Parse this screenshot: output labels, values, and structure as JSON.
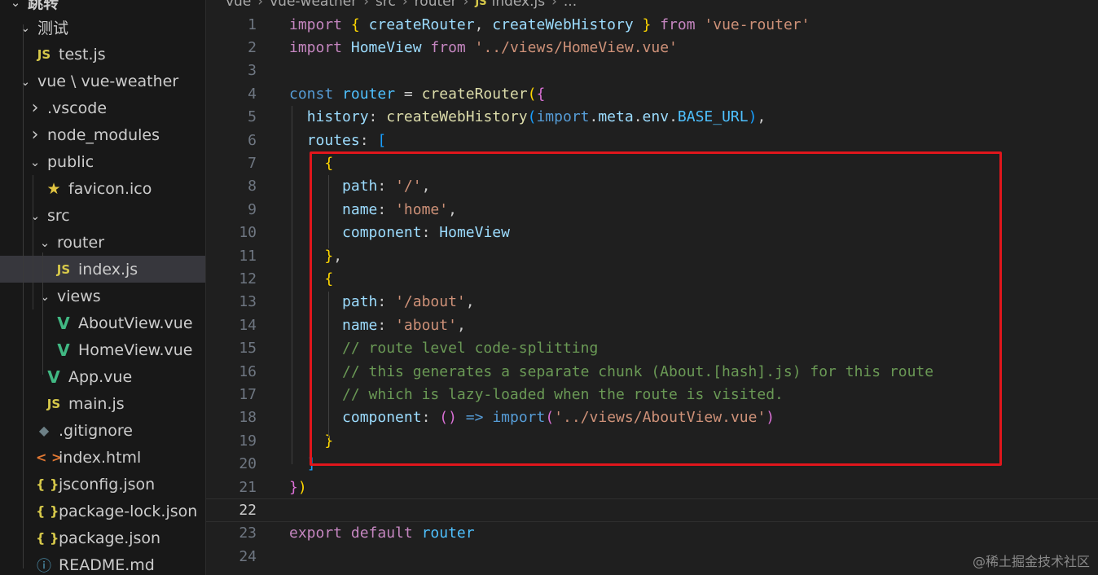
{
  "breadcrumb": [
    "vue",
    "vue-weather",
    "src",
    "router",
    "index.js",
    "..."
  ],
  "explorer": {
    "top_partial": "跳转",
    "items": [
      {
        "label": "测试",
        "type": "folder-open"
      },
      {
        "label": "test.js",
        "type": "js"
      },
      {
        "label": "vue \\ vue-weather",
        "type": "folder-open"
      },
      {
        "label": ".vscode",
        "type": "folder-closed"
      },
      {
        "label": "node_modules",
        "type": "folder-closed"
      },
      {
        "label": "public",
        "type": "folder-open"
      },
      {
        "label": "favicon.ico",
        "type": "star"
      },
      {
        "label": "src",
        "type": "folder-open"
      },
      {
        "label": "router",
        "type": "folder-open"
      },
      {
        "label": "index.js",
        "type": "js",
        "selected": true
      },
      {
        "label": "views",
        "type": "folder-open"
      },
      {
        "label": "AboutView.vue",
        "type": "vue"
      },
      {
        "label": "HomeView.vue",
        "type": "vue"
      },
      {
        "label": "App.vue",
        "type": "vue"
      },
      {
        "label": "main.js",
        "type": "js"
      },
      {
        "label": ".gitignore",
        "type": "git"
      },
      {
        "label": "index.html",
        "type": "html"
      },
      {
        "label": "jsconfig.json",
        "type": "json"
      },
      {
        "label": "package-lock.json",
        "type": "json"
      },
      {
        "label": "package.json",
        "type": "json"
      },
      {
        "label": "README.md",
        "type": "info"
      }
    ]
  },
  "icons": {
    "js": "JS",
    "json": "{ }",
    "html": "< >",
    "vue": "V",
    "star": "★",
    "git": "◆",
    "info": "ⓘ",
    "chevron_down": "⌄",
    "chevron_right": "›"
  },
  "code": {
    "active_line": 22,
    "lines": [
      [
        [
          "kw2",
          "import"
        ],
        [
          "punc",
          " "
        ],
        [
          "b1",
          "{"
        ],
        [
          "punc",
          " "
        ],
        [
          "var",
          "createRouter"
        ],
        [
          "punc",
          ", "
        ],
        [
          "var",
          "createWebHistory"
        ],
        [
          "punc",
          " "
        ],
        [
          "b1",
          "}"
        ],
        [
          "punc",
          " "
        ],
        [
          "kw2",
          "from"
        ],
        [
          "punc",
          " "
        ],
        [
          "str",
          "'vue-router'"
        ]
      ],
      [
        [
          "kw2",
          "import"
        ],
        [
          "punc",
          " "
        ],
        [
          "var",
          "HomeView"
        ],
        [
          "punc",
          " "
        ],
        [
          "kw2",
          "from"
        ],
        [
          "punc",
          " "
        ],
        [
          "str",
          "'../views/HomeView.vue'"
        ]
      ],
      [],
      [
        [
          "kw",
          "const"
        ],
        [
          "punc",
          " "
        ],
        [
          "cst",
          "router"
        ],
        [
          "punc",
          " = "
        ],
        [
          "fn",
          "createRouter"
        ],
        [
          "b1",
          "("
        ],
        [
          "b2",
          "{"
        ]
      ],
      [
        [
          "punc",
          "  "
        ],
        [
          "var",
          "history"
        ],
        [
          "punc",
          ": "
        ],
        [
          "fn",
          "createWebHistory"
        ],
        [
          "b3",
          "("
        ],
        [
          "kw",
          "import"
        ],
        [
          "punc",
          "."
        ],
        [
          "var",
          "meta"
        ],
        [
          "punc",
          "."
        ],
        [
          "var",
          "env"
        ],
        [
          "punc",
          "."
        ],
        [
          "cst",
          "BASE_URL"
        ],
        [
          "b3",
          ")"
        ],
        [
          "punc",
          ","
        ]
      ],
      [
        [
          "punc",
          "  "
        ],
        [
          "var",
          "routes"
        ],
        [
          "punc",
          ": "
        ],
        [
          "b3",
          "["
        ]
      ],
      [
        [
          "punc",
          "    "
        ],
        [
          "b1",
          "{"
        ]
      ],
      [
        [
          "punc",
          "      "
        ],
        [
          "var",
          "path"
        ],
        [
          "punc",
          ": "
        ],
        [
          "str",
          "'/'"
        ],
        [
          "punc",
          ","
        ]
      ],
      [
        [
          "punc",
          "      "
        ],
        [
          "var",
          "name"
        ],
        [
          "punc",
          ": "
        ],
        [
          "str",
          "'home'"
        ],
        [
          "punc",
          ","
        ]
      ],
      [
        [
          "punc",
          "      "
        ],
        [
          "var",
          "component"
        ],
        [
          "punc",
          ": "
        ],
        [
          "var",
          "HomeView"
        ]
      ],
      [
        [
          "punc",
          "    "
        ],
        [
          "b1",
          "}"
        ],
        [
          "punc",
          ","
        ]
      ],
      [
        [
          "punc",
          "    "
        ],
        [
          "b1",
          "{"
        ]
      ],
      [
        [
          "punc",
          "      "
        ],
        [
          "var",
          "path"
        ],
        [
          "punc",
          ": "
        ],
        [
          "str",
          "'/about'"
        ],
        [
          "punc",
          ","
        ]
      ],
      [
        [
          "punc",
          "      "
        ],
        [
          "var",
          "name"
        ],
        [
          "punc",
          ": "
        ],
        [
          "str",
          "'about'"
        ],
        [
          "punc",
          ","
        ]
      ],
      [
        [
          "punc",
          "      "
        ],
        [
          "cmt",
          "// route level code-splitting"
        ]
      ],
      [
        [
          "punc",
          "      "
        ],
        [
          "cmt",
          "// this generates a separate chunk (About.[hash].js) for this route"
        ]
      ],
      [
        [
          "punc",
          "      "
        ],
        [
          "cmt",
          "// which is lazy-loaded when the route is visited."
        ]
      ],
      [
        [
          "punc",
          "      "
        ],
        [
          "var",
          "component"
        ],
        [
          "punc",
          ": "
        ],
        [
          "b2",
          "()"
        ],
        [
          "punc",
          " "
        ],
        [
          "kw",
          "=>"
        ],
        [
          "punc",
          " "
        ],
        [
          "kw",
          "import"
        ],
        [
          "b2",
          "("
        ],
        [
          "str",
          "'../views/AboutView.vue'"
        ],
        [
          "b2",
          ")"
        ]
      ],
      [
        [
          "punc",
          "    "
        ],
        [
          "b1",
          "}"
        ]
      ],
      [
        [
          "punc",
          "  "
        ],
        [
          "b3",
          "]"
        ]
      ],
      [
        [
          "b2",
          "}"
        ],
        [
          "b1",
          ")"
        ]
      ],
      [],
      [
        [
          "kw2",
          "export"
        ],
        [
          "punc",
          " "
        ],
        [
          "kw2",
          "default"
        ],
        [
          "punc",
          " "
        ],
        [
          "cst",
          "router"
        ]
      ],
      []
    ]
  },
  "watermark": "@稀土掘金技术社区"
}
